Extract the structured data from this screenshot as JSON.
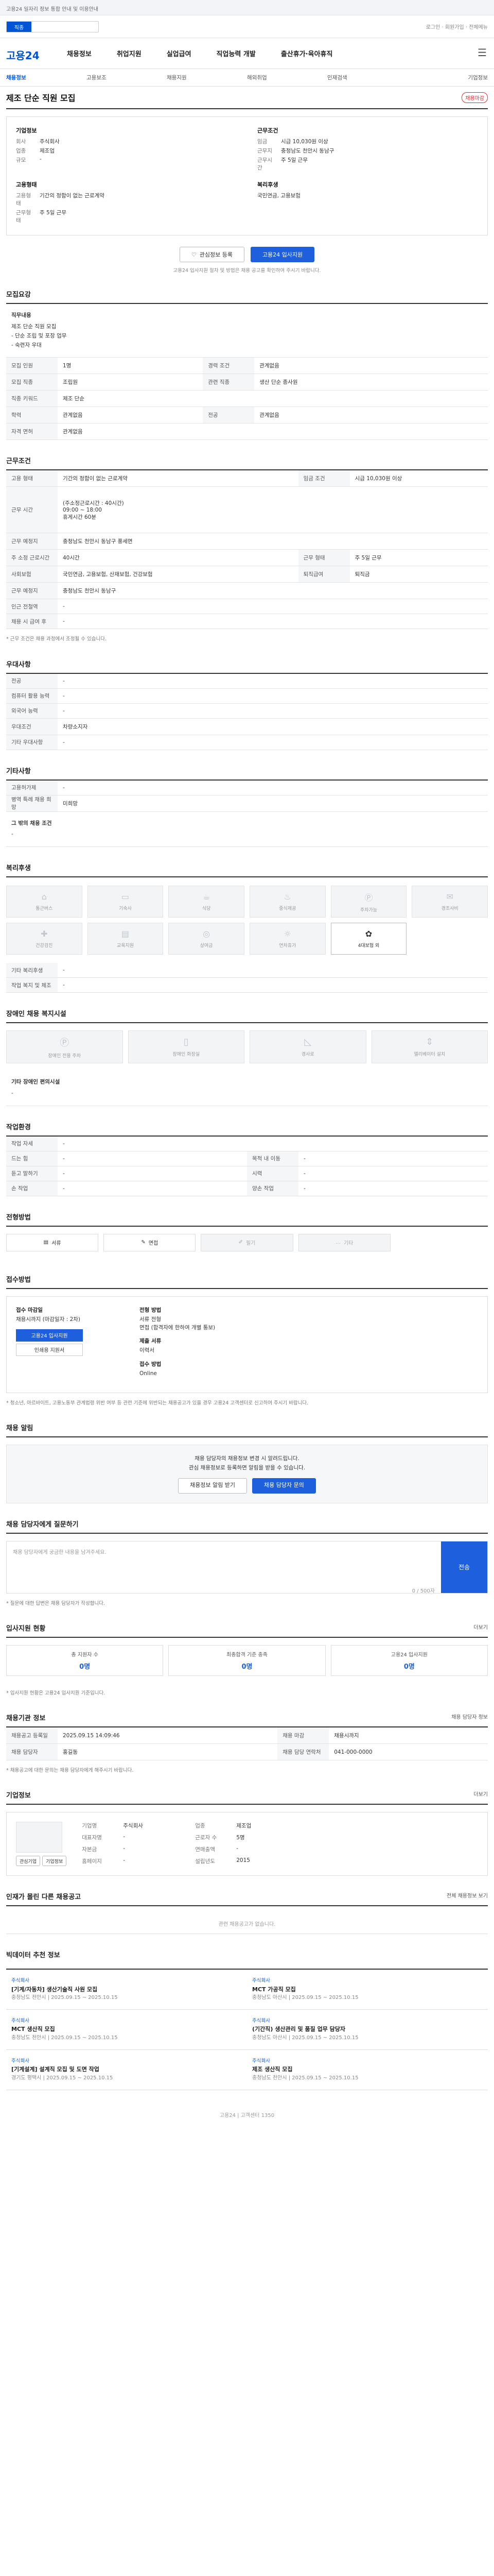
{
  "topbar": {
    "notice": "고용24 일자리 정보 통합 안내 및 이용안내"
  },
  "search": {
    "label": "직종",
    "placeholder": ""
  },
  "util": {
    "links": "로그인 · 회원가입 · 전체메뉴"
  },
  "logo": "고용24",
  "gnb": [
    "채용정보",
    "취업지원",
    "실업급여",
    "직업능력 개발",
    "출산휴가·육아휴직"
  ],
  "subnav": [
    "채용정보",
    "고용보조",
    "채용지원",
    "해외취업",
    "인재검색",
    "기업정보"
  ],
  "job": {
    "title": "제조 단순 직원 모집",
    "badge": "채용마감",
    "company_h": "기업정보",
    "company_rows": [
      [
        "회사",
        "주식회사"
      ],
      [
        "업종",
        "제조업"
      ],
      [
        "규모",
        "-"
      ]
    ],
    "cond_h": "근무조건",
    "cond_rows": [
      [
        "임금",
        "시급 10,030원 이상"
      ],
      [
        "근무지",
        "충청남도 천안시 동남구"
      ],
      [
        "근무시간",
        "주 5일 근무"
      ]
    ],
    "type_h": "고용형태",
    "type_rows": [
      [
        "고용형태",
        "기간의 정함이 없는 근로계약"
      ],
      [
        "근무형태",
        "주 5일 근무"
      ]
    ],
    "welfare_h": "복리후생",
    "welfare_rows": [
      [
        "",
        "국민연금, 고용보험"
      ]
    ]
  },
  "actions": {
    "scrap": "관심정보 등록",
    "apply": "고용24 입사지원"
  },
  "note": "고용24 입사지원 절차 및 방법은 채용 공고를 확인하여 주시기 바랍니다.",
  "recruit": {
    "title": "모집요강",
    "desc_h": "직무내용",
    "desc": "제조 단순 직원 모집\n- 단순 조립 및 포장 업무\n- 숙련자 우대",
    "rows": [
      [
        "모집 인원",
        "1명",
        "경력 조건",
        "관계없음"
      ],
      [
        "모집 직종",
        "조립원",
        "관련 직종",
        "생산 단순 종사원"
      ],
      [
        "직종 키워드",
        "제조 단순",
        "",
        ""
      ],
      [
        "학력",
        "관계없음",
        "전공",
        "관계없음"
      ],
      [
        "자격 면허",
        "관계없음",
        "",
        ""
      ]
    ]
  },
  "work": {
    "title": "근무조건",
    "rows": [
      [
        "고용 형태",
        "기간의 정함이 없는 근로계약",
        "임금 조건",
        "시급 10,030원 이상"
      ],
      [
        "근무 시간",
        "(주소정근로시간 : 40시간)\n09:00 ~ 18:00\n휴게시간 60분",
        ""
      ],
      [
        "근무 예정지",
        "충청남도 천안시 동남구 풍세면",
        "",
        ""
      ],
      [
        "주 소정 근로시간",
        "40시간",
        "근무 형태",
        "주 5일 근무"
      ],
      [
        "사회보험",
        "국민연금, 고용보험, 산재보험, 건강보험",
        "퇴직급여",
        "퇴직금"
      ],
      [
        "근무 예정지",
        "충청남도 천안시 동남구",
        "",
        ""
      ],
      [
        "인근 전철역",
        "-",
        "",
        ""
      ],
      [
        "채용 시 급여 후",
        "-",
        "",
        ""
      ]
    ],
    "note": "* 근무 조건은 채용 과정에서 조정될 수 있습니다."
  },
  "prefer": {
    "title": "우대사항",
    "rows": [
      [
        "전공",
        "-"
      ],
      [
        "컴퓨터 활용 능력",
        "-"
      ],
      [
        "외국어 능력",
        "-"
      ],
      [
        "우대조건",
        "차량소지자"
      ],
      [
        "기타 우대사항",
        "-"
      ]
    ]
  },
  "etc": {
    "title": "기타사항",
    "rows": [
      [
        "고용허가제",
        "-"
      ],
      [
        "병역 특례 채용 희망",
        "미희망"
      ]
    ],
    "sub_h": "그 밖의 채용 조건",
    "sub_v": "-"
  },
  "welfare": {
    "title": "복리후생",
    "items": [
      {
        "icon": "house-icon",
        "label": "통근버스",
        "on": false
      },
      {
        "icon": "bed-icon",
        "label": "기숙사",
        "on": false
      },
      {
        "icon": "cup-icon",
        "label": "식당",
        "on": false
      },
      {
        "icon": "meal-icon",
        "label": "중식제공",
        "on": false
      },
      {
        "icon": "parking-icon",
        "label": "주차가능",
        "on": false
      },
      {
        "icon": "gift-icon",
        "label": "경조사비",
        "on": false
      },
      {
        "icon": "health-icon",
        "label": "건강검진",
        "on": false
      },
      {
        "icon": "book-icon",
        "label": "교육지원",
        "on": false
      },
      {
        "icon": "bonus-icon",
        "label": "상여금",
        "on": false
      },
      {
        "icon": "vacation-icon",
        "label": "연차휴가",
        "on": false
      },
      {
        "icon": "shirt-icon",
        "label": "4대보험 외",
        "on": true
      }
    ],
    "rows": [
      [
        "기타 복리후생",
        "-"
      ],
      [
        "작업 복지 및 체조",
        "-"
      ]
    ]
  },
  "disability": {
    "title": "장애인 채용 복지시설",
    "items": [
      {
        "icon": "parking-icon",
        "label": "장애인 전용 주차"
      },
      {
        "icon": "door-icon",
        "label": "장애인 화장실"
      },
      {
        "icon": "ramp-icon",
        "label": "경사로"
      },
      {
        "icon": "elevator-icon",
        "label": "엘리베이터 설치"
      }
    ],
    "sub_h": "기타 장애인 편의시설",
    "sub_v": "-"
  },
  "env": {
    "title": "작업환경",
    "rows": [
      [
        "작업 자세",
        "-",
        "",
        ""
      ],
      [
        "드는 힘",
        "-",
        "목적 내 이동",
        "-"
      ],
      [
        "듣고 말하기",
        "-",
        "시력",
        "-"
      ],
      [
        "손 작업",
        "-",
        "양손 작업",
        "-"
      ]
    ]
  },
  "method": {
    "title": "전형방법",
    "items": [
      {
        "icon": "doc-icon",
        "label": "서류",
        "on": true
      },
      {
        "icon": "talk-icon",
        "label": "면접",
        "on": true
      },
      {
        "icon": "pen-icon",
        "label": "필기",
        "on": false
      },
      {
        "icon": "etc-icon",
        "label": "기타",
        "on": false
      }
    ]
  },
  "apply": {
    "title": "접수방법",
    "deadline_h": "접수 마감일",
    "deadline_v": "채용시까지 (마감일자 : 2차)",
    "btn_apply": "고용24 입사지원",
    "btn_print": "인쇄용 지원서",
    "docs_h": "전형 방법",
    "docs_v": "서류 전형\n면접 (합격자에 한하여 개별 통보)",
    "submit_h": "제출 서류",
    "submit_v": "이력서",
    "method_h": "접수 방법",
    "method_v": "Online",
    "warn": "* 청소년, 아르바이트, 고용노동부 관계법령 위반 여부 등 관련 기준에 위반되는 채용공고가 있을 경우 고용24 고객센터로 신고하여 주시기 바랍니다."
  },
  "alarm": {
    "title": "채용 알림",
    "text": "채용 담당자의 채용정보 변경 시 알려드립니다.\n관심 채용정보로 등록하면 알림을 받을 수 있습니다.",
    "btn1": "채용정보 알림 받기",
    "btn2": "채용 담당자 문의"
  },
  "qa": {
    "title": "채용 담당자에게 질문하기",
    "hint": "채용 담당자에게 궁금한 내용을 남겨주세요.",
    "counter": "0 / 500자",
    "send": "전송",
    "note": "* 질문에 대한 답변은 채용 담당자가 작성합니다."
  },
  "stats": {
    "title": "입사지원 현황",
    "more": "더보기",
    "items": [
      {
        "n": "0명",
        "l": "총 지원자 수"
      },
      {
        "n": "0명",
        "l": "최종합격 기준 충족"
      },
      {
        "n": "0명",
        "l": "고용24 입사지원"
      }
    ],
    "note": "* 입사지원 현황은 고용24 입사지원 기준입니다."
  },
  "manager": {
    "title": "채용기관 정보",
    "more": "채용 담당자 정보",
    "rows": [
      [
        "채용공고 등록일",
        "2025.09.15 14:09:46",
        "채용 마감",
        "채용시까지"
      ],
      [
        "채용 담당자",
        "홍길동",
        "채용 담당 연락처",
        "041-000-0000"
      ]
    ],
    "note": "* 채용공고에 대한 문의는 채용 담당자에게 해주시기 바랍니다."
  },
  "company": {
    "title": "기업정보",
    "more": "더보기",
    "rows": [
      [
        "기업명",
        "주식회사",
        "업종",
        "제조업"
      ],
      [
        "대표자명",
        "-",
        "근로자 수",
        "5명"
      ],
      [
        "자본금",
        "-",
        "연매출액",
        "-"
      ],
      [
        "홈페이지",
        "-",
        "설립년도",
        "2015"
      ]
    ],
    "btn1": "관심기업",
    "btn2": "기업정보"
  },
  "others": {
    "title": "인재가 몰린 다른 채용공고",
    "more": "전체 채용정보 보기",
    "empty": "관련 채용공고가 없습니다."
  },
  "recommend": {
    "title": "빅데이터 추천 정보",
    "items": [
      {
        "c": "주식회사",
        "t": "[기계/자동차] 생산기술직 사원 모집",
        "m": "충청남도 천안시 | 2025.09.15 ~ 2025.10.15"
      },
      {
        "c": "주식회사",
        "t": "MCT 가공직 모집",
        "m": "충청남도 아산시 | 2025.09.15 ~ 2025.10.15"
      },
      {
        "c": "주식회사",
        "t": "MCT 생산직 모집",
        "m": "충청남도 천안시 | 2025.09.15 ~ 2025.10.15"
      },
      {
        "c": "주식회사",
        "t": "(기간직) 생산관리 및 품질 업무 담당자",
        "m": "충청남도 아산시 | 2025.09.15 ~ 2025.10.15"
      },
      {
        "c": "주식회사",
        "t": "[기계설계] 설계직 모집 및 도면 작업",
        "m": "경기도 평택시 | 2025.09.15 ~ 2025.10.15"
      },
      {
        "c": "주식회사",
        "t": "제조 생산직 모집",
        "m": "충청남도 천안시 | 2025.09.15 ~ 2025.10.15"
      }
    ]
  },
  "footer": "고용24 | 고객센터 1350"
}
